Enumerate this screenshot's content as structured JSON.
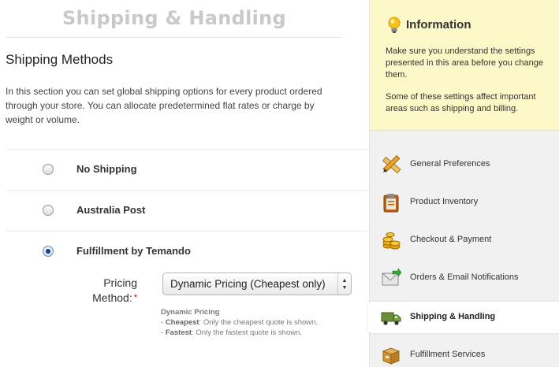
{
  "page": {
    "title": "Shipping & Handling"
  },
  "shipping": {
    "section_title": "Shipping Methods",
    "description": "In this section you can set global shipping options for every product ordered through your store. You can allocate predetermined flat rates or charge by weight or volume.",
    "options": [
      {
        "label": "No Shipping",
        "selected": false
      },
      {
        "label": "Australia Post",
        "selected": false
      },
      {
        "label": "Fulfillment by Temando",
        "selected": true
      }
    ],
    "pricing": {
      "label": "Pricing Method:",
      "required_mark": "*",
      "selected_value": "Dynamic Pricing (Cheapest only)",
      "help_title": "Dynamic Pricing",
      "help_items": [
        {
          "term": "Cheapest",
          "text": ": Only the cheapest quote is shown."
        },
        {
          "term": "Fastest",
          "text": ": Only the fastest quote is shown."
        }
      ]
    }
  },
  "sidebar": {
    "info": {
      "title": "Information",
      "icon": "lightbulb-icon",
      "paragraphs": [
        "Make sure you understand the settings presented in this area before you change them.",
        "Some of these settings affect important areas such as shipping and billing."
      ]
    },
    "nav": [
      {
        "label": "General Preferences",
        "icon": "pencil-ruler-icon",
        "active": false
      },
      {
        "label": "Product Inventory",
        "icon": "clipboard-icon",
        "active": false
      },
      {
        "label": "Checkout & Payment",
        "icon": "coins-icon",
        "active": false
      },
      {
        "label": "Orders & Email Notifications",
        "icon": "envelope-icon",
        "active": false
      },
      {
        "label": "Shipping & Handling",
        "icon": "truck-icon",
        "active": true
      },
      {
        "label": "Fulfillment Services",
        "icon": "box-icon",
        "active": false
      }
    ]
  },
  "colors": {
    "info_background": "#fdf8c7",
    "sidebar_background": "#f1f1f1",
    "required": "#cc0000",
    "title_gray": "#c9c9c9"
  }
}
